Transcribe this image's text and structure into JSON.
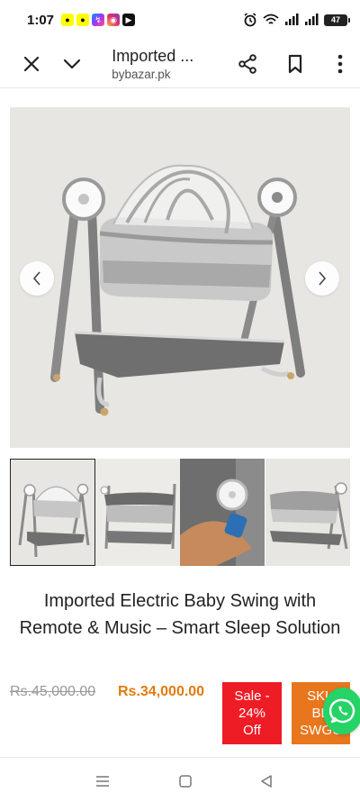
{
  "status_bar": {
    "time": "1:07",
    "battery": "47",
    "notification_icons": [
      "snapchat-icon",
      "snapchat-icon",
      "messenger-icon",
      "instagram-icon",
      "youtube-icon"
    ],
    "system_icons": [
      "alarm-icon",
      "wifi-icon",
      "signal-icon",
      "signal-icon",
      "battery-icon"
    ]
  },
  "toolbar": {
    "title": "Imported ...",
    "url": "bybazar.pk",
    "icons": [
      "close-icon",
      "chevron-down-icon",
      "share-icon",
      "bookmark-icon",
      "more-vert-icon"
    ]
  },
  "product": {
    "title": "Imported Electric Baby Swing with Remote & Music – Smart Sleep Solution",
    "old_price": "Rs.45,000.00",
    "new_price": "Rs.34,000.00",
    "sale_badge": [
      "Sale -",
      "24%",
      "Off"
    ],
    "sku_badge": [
      "SKU",
      "BE",
      "SWGU"
    ]
  },
  "gallery": {
    "thumbnail_count": 4,
    "active_index": 0
  },
  "colors": {
    "price": "#e07b0b",
    "sale_badge": "#ee1c25",
    "sku_badge": "#e8761d",
    "whatsapp": "#25d366"
  },
  "nav_bar": {
    "icons": [
      "recent-apps-icon",
      "home-icon",
      "back-icon"
    ]
  }
}
